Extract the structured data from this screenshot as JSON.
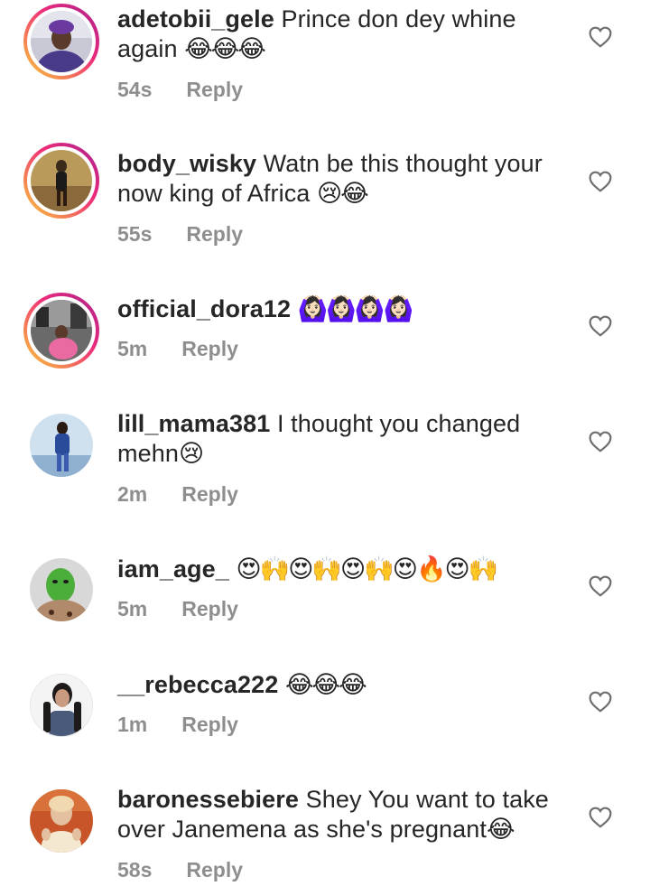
{
  "comments": [
    {
      "username": "adetobii_gele",
      "text": "Prince don dey whine again",
      "emojis": "😂😂😂",
      "time": "54s",
      "reply": "Reply"
    },
    {
      "username": "body_wisky",
      "text": "Watn be this thought your now king of Africa",
      "emojis": "😢😂",
      "time": "55s",
      "reply": "Reply"
    },
    {
      "username": "official_dora12",
      "text": "",
      "emojis": "🙆🏻‍♀️🙆🏻‍♀️🙆🏻‍♀️🙆🏻‍♀️",
      "time": "5m",
      "reply": "Reply"
    },
    {
      "username": "lill_mama381",
      "text": "I thought you changed mehn",
      "emojis": "😢",
      "time": "2m",
      "reply": "Reply"
    },
    {
      "username": "iam_age_",
      "text": "",
      "emojis": "😍🙌😍🙌😍🙌😍🔥😍🙌",
      "time": "5m",
      "reply": "Reply"
    },
    {
      "username": "__rebecca222",
      "text": "",
      "emojis": "😂😂😂",
      "time": "1m",
      "reply": "Reply"
    },
    {
      "username": "baronessebiere",
      "text": "Shey You want to take over Janemena as she's pregnant",
      "emojis": "😂",
      "time": "58s",
      "reply": "Reply"
    }
  ],
  "colors": {
    "text": "#262626",
    "secondary": "#8e8e8e",
    "story_ring_start": "#f9ce34",
    "story_ring_end": "#a5238f"
  },
  "icons": {
    "like": "heart-outline-icon",
    "avatar": "avatar-photo"
  }
}
